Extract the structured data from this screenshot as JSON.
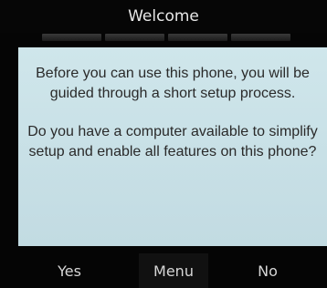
{
  "header": {
    "title": "Welcome",
    "progress_segments": 4
  },
  "dialog": {
    "paragraph1": "Before you can use this phone, you will be guided through a short setup process.",
    "paragraph2": "Do you have a computer available to simplify setup and enable all features on this phone?"
  },
  "softkeys": {
    "left_label": "Yes",
    "center_label": "Menu",
    "right_label": "No"
  },
  "colors": {
    "dialog_background": "#c8e0e6",
    "screen_background": "#050505",
    "text_light": "#e8e8e8"
  }
}
